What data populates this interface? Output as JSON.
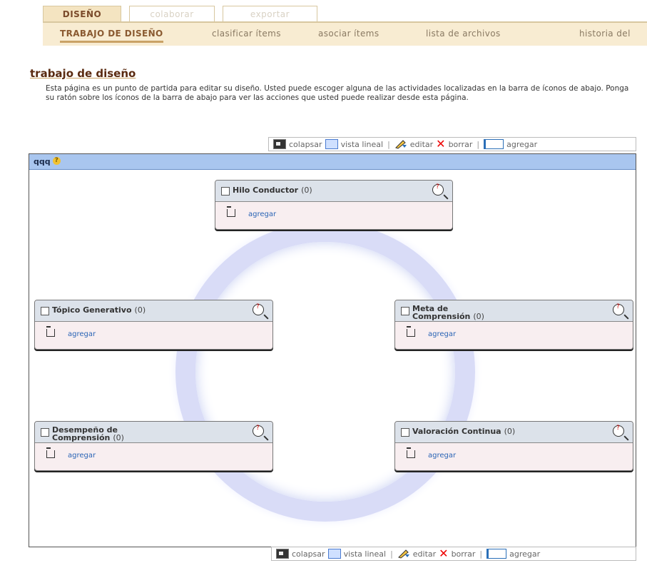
{
  "tabs": {
    "top": [
      "DISEÑO",
      "colaborar",
      "exportar"
    ],
    "sub": [
      "TRABAJO DE DISEÑO",
      "clasificar ítems",
      "asociar ítems",
      "lista de archivos",
      "historia del"
    ]
  },
  "page": {
    "title": "trabajo de diseño",
    "intro": "Esta página es un punto de partida para editar su diseño. Usted puede escoger alguna de las actividades localizadas en la barra de íconos de abajo. Ponga su ratón sobre los íconos de la barra de abajo para ver las acciones que usted puede realizar desde esta página."
  },
  "toolbar": {
    "collapse": "colapsar",
    "linear": "vista lineal",
    "edit": "editar",
    "delete": "borrar",
    "add": "agregar"
  },
  "panel": {
    "title": "qqq"
  },
  "items": [
    {
      "title": "Hilo Conductor",
      "count": "(0)",
      "add": "agregar"
    },
    {
      "title": "Tópico Generativo",
      "count": "(0)",
      "add": "agregar"
    },
    {
      "title": "Meta de",
      "title2": "Comprensión",
      "count": "(0)",
      "add": "agregar"
    },
    {
      "title": "Desempeño de",
      "title2": "Comprensión",
      "count": "(0)",
      "add": "agregar"
    },
    {
      "title": "Valoración Continua",
      "count": "(0)",
      "add": "agregar"
    }
  ]
}
